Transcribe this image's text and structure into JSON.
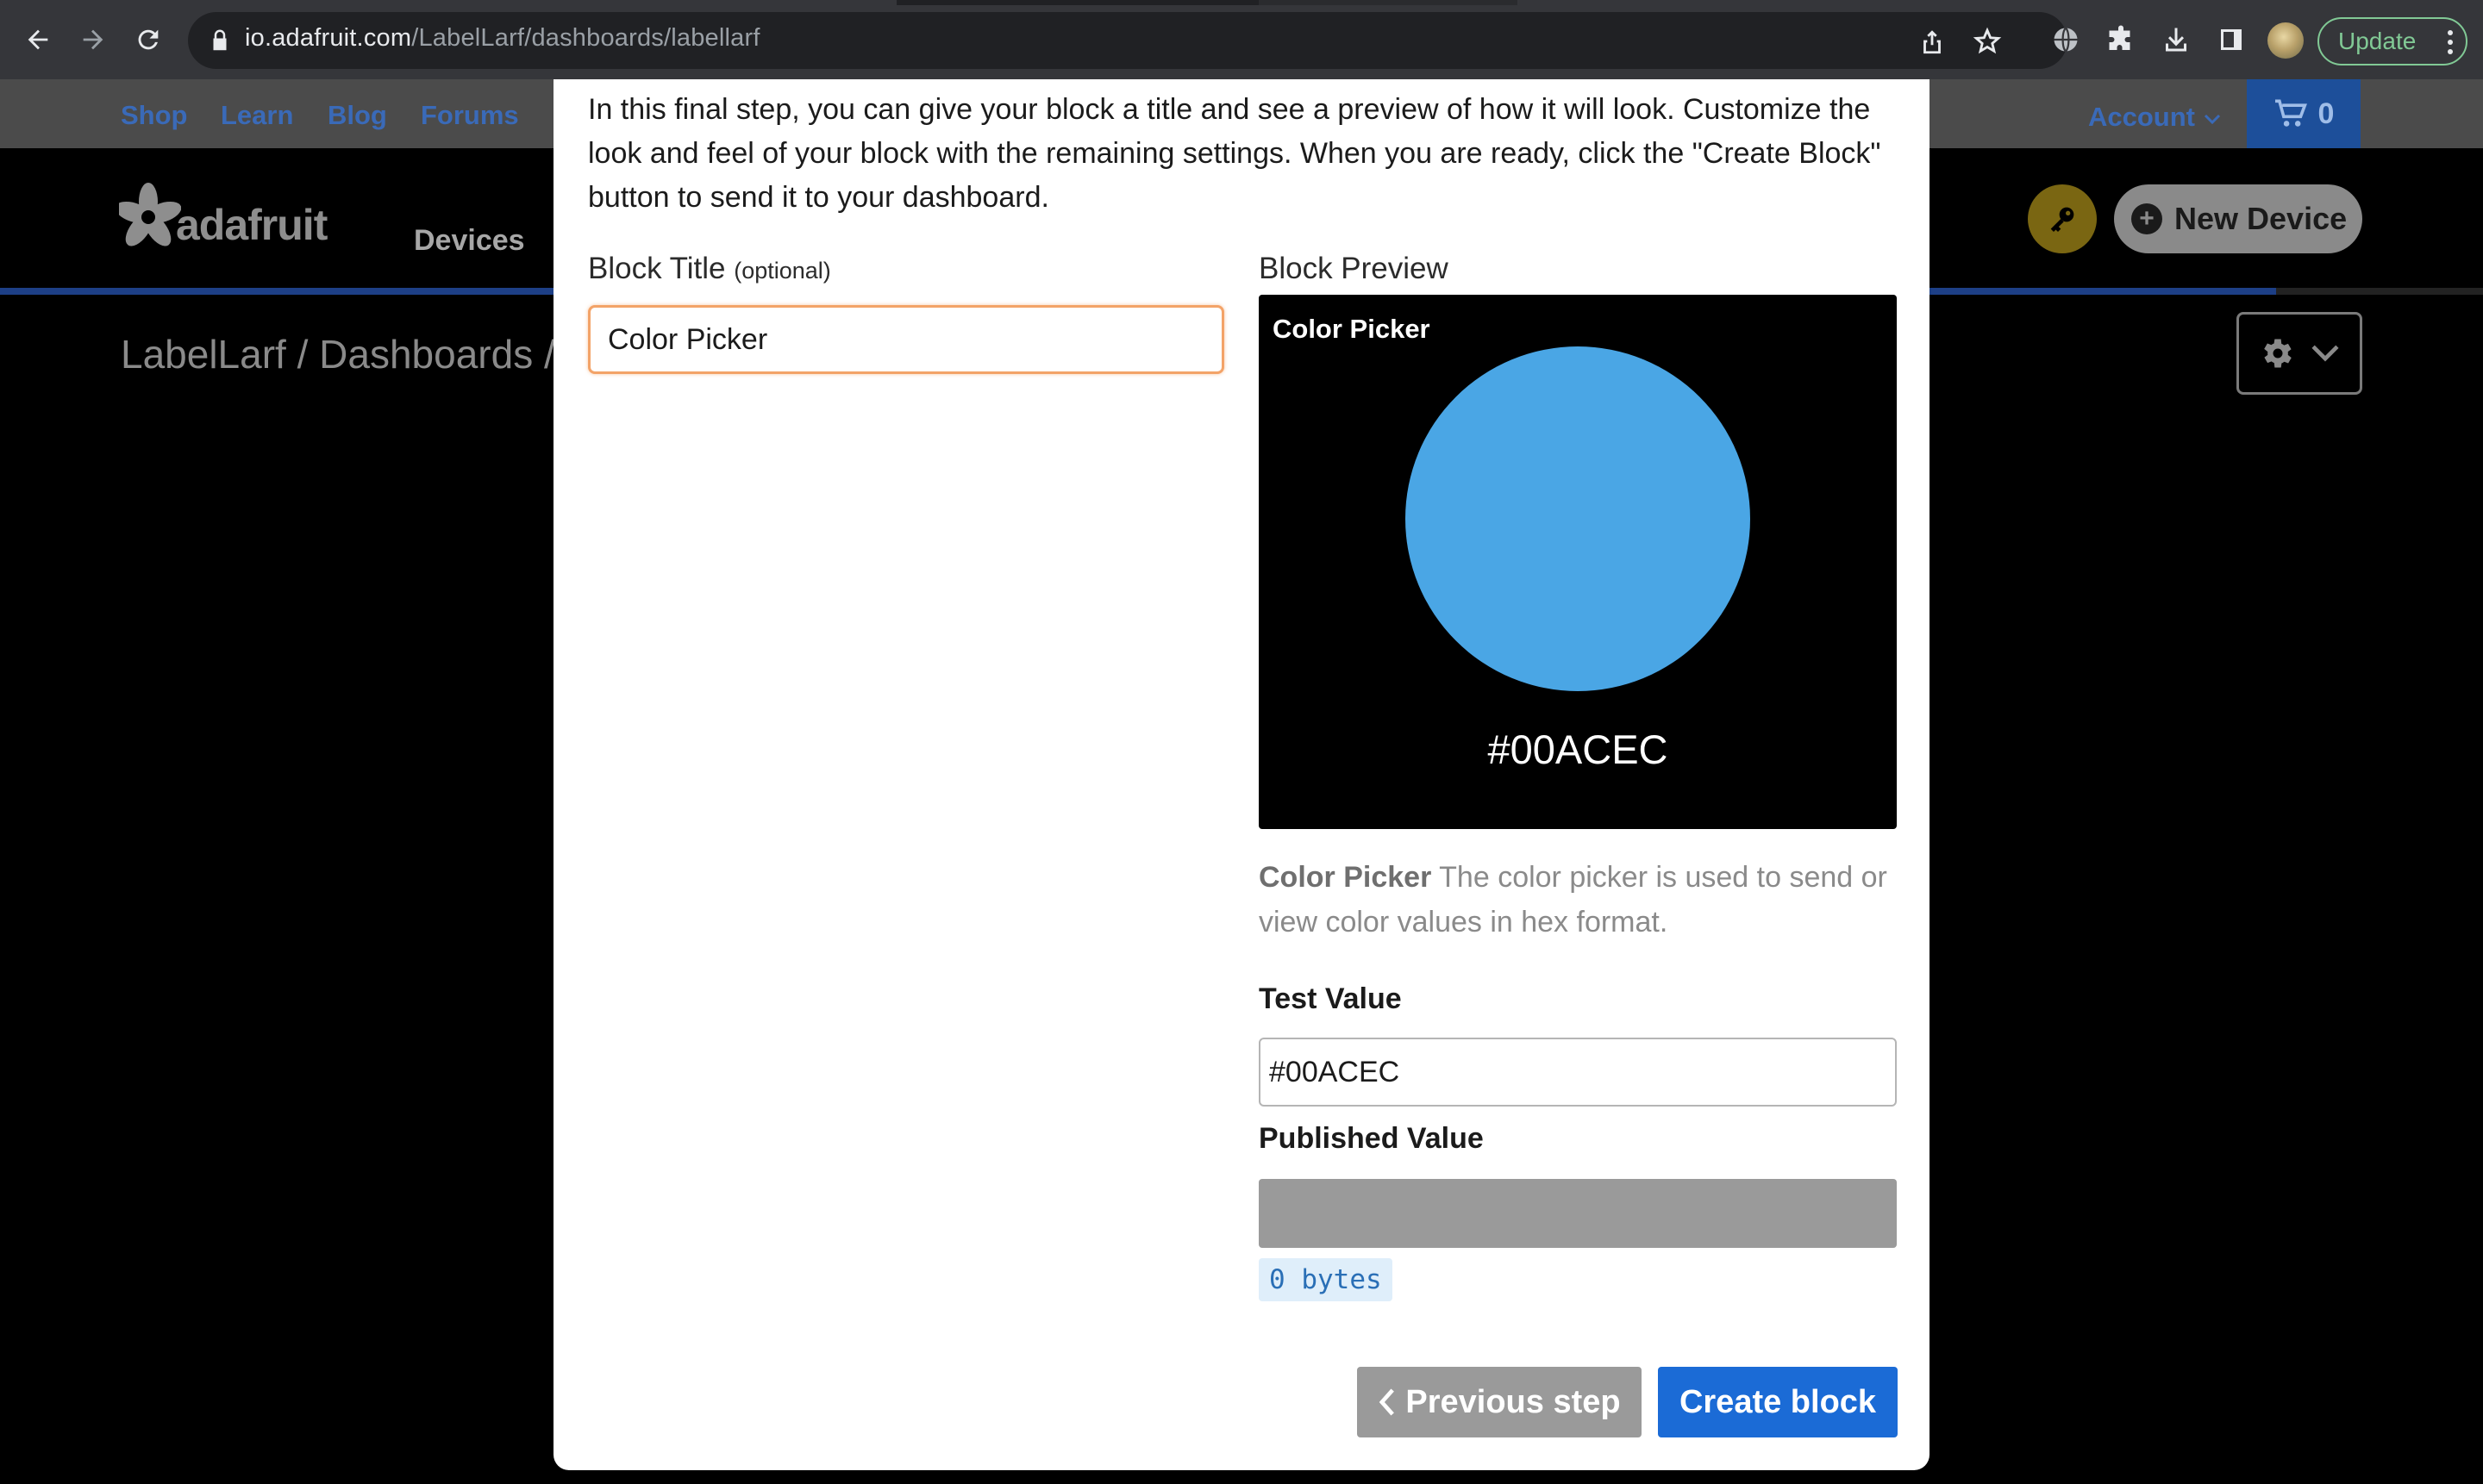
{
  "browser": {
    "url_host": "io.adafruit.com",
    "url_path": "/LabelLarf/dashboards/labellarf",
    "update_label": "Update"
  },
  "topbar": {
    "links": [
      "Shop",
      "Learn",
      "Blog",
      "Forums"
    ],
    "account_label": "Account",
    "cart_count": "0"
  },
  "io_header": {
    "logo_text": "adafruit",
    "nav_devices": "Devices",
    "new_device_label": "New Device"
  },
  "breadcrumb": "LabelLarf / Dashboards /",
  "modal": {
    "intro": "In this final step, you can give your block a title and see a preview of how it will look. Customize the look and feel of your block with the remaining settings. When you are ready, click the \"Create Block\" button to send it to your dashboard.",
    "block_title_label": "Block Title",
    "block_title_optional": "(optional)",
    "block_title_value": "Color Picker",
    "preview_label": "Block Preview",
    "preview": {
      "title": "Color Picker",
      "hex": "#00ACEC",
      "swatch_color": "#4aa6e5"
    },
    "description_name": "Color Picker",
    "description_text": "The color picker is used to send or view color values in hex format.",
    "test_value_label": "Test Value",
    "test_value": "#00ACEC",
    "published_value_label": "Published Value",
    "bytes_label": "0 bytes",
    "previous_button": "Previous step",
    "create_button": "Create block"
  },
  "colors": {
    "accent_blue": "#1b6bd6",
    "input_focus": "#f3a368",
    "key_button": "#7a6612"
  }
}
